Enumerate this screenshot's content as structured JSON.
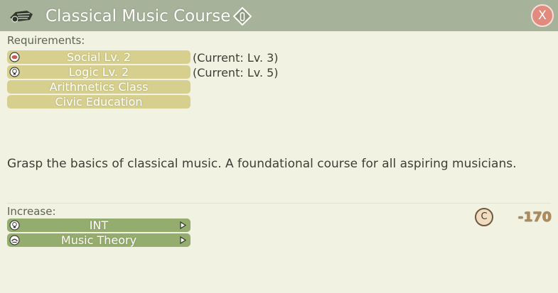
{
  "window": {
    "title": "Classical Music Course",
    "title_icon": "instrument-icon",
    "info_icon": "info-diamond-icon",
    "close_label": "X"
  },
  "requirements": {
    "label": "Requirements:",
    "items": [
      {
        "label": "Social Lv. 2",
        "icon": "social-icon",
        "current": "(Current: Lv. 3)"
      },
      {
        "label": "Logic Lv. 2",
        "icon": "lightbulb-icon",
        "current": "(Current: Lv. 5)"
      },
      {
        "label": "Arithmetics Class"
      },
      {
        "label": "Civic Education"
      }
    ]
  },
  "description": "Grasp the basics of classical music. A foundational course for all aspiring musicians.",
  "increase": {
    "label": "Increase:",
    "items": [
      {
        "label": "INT",
        "icon": "lightbulb-icon"
      },
      {
        "label": "Music Theory",
        "icon": "music-theory-icon"
      }
    ]
  },
  "cost": {
    "coin_symbol": "C",
    "value": "-170"
  },
  "colors": {
    "titlebar": "#a7b29a",
    "background": "#f2f2e2",
    "requirement_pill": "#d6cf8e",
    "increase_pill": "#94ac6e",
    "close_button": "#e28a7e",
    "cost_text": "#b08a58"
  }
}
